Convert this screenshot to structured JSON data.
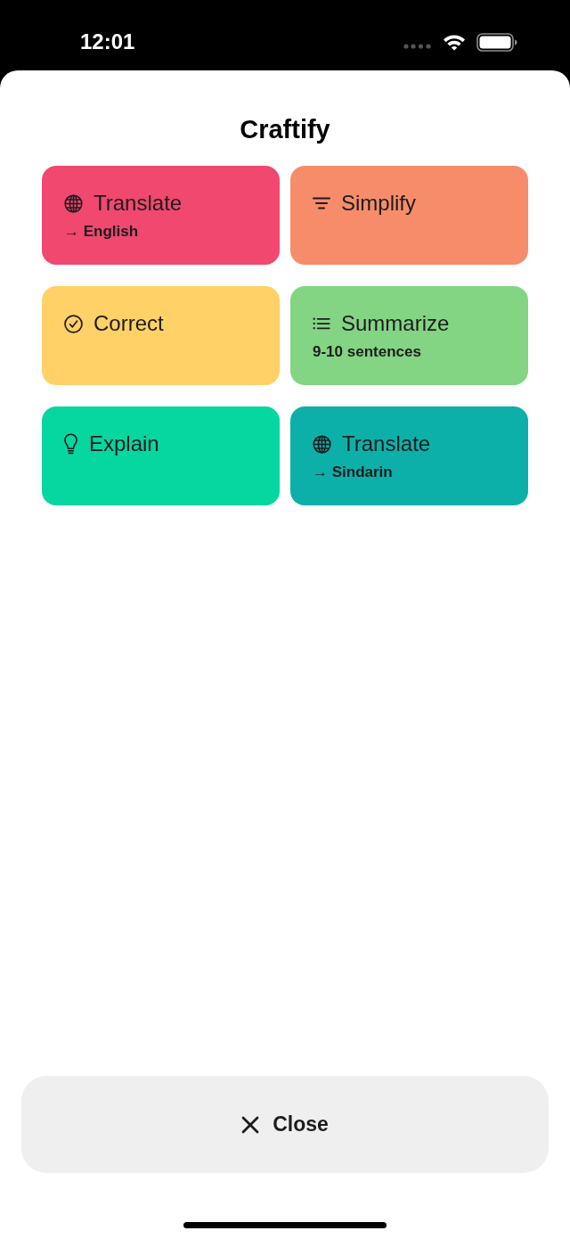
{
  "status_bar": {
    "time": "12:01"
  },
  "sheet": {
    "title": "Craftify"
  },
  "actions": [
    {
      "kind": "translate",
      "label": "Translate",
      "detail": "→ English",
      "color": "#f0486f"
    },
    {
      "kind": "simplify",
      "label": "Simplify",
      "color": "#f78c6b"
    },
    {
      "kind": "correct",
      "label": "Correct",
      "color": "#ffd166"
    },
    {
      "kind": "summarize",
      "label": "Summarize",
      "detail": "9-10 sentences",
      "color": "#83d483"
    },
    {
      "kind": "explain",
      "label": "Explain",
      "color": "#06d6a0"
    },
    {
      "kind": "translate",
      "label": "Translate",
      "detail": "→ Sindarin",
      "color": "#0cb0a9"
    }
  ],
  "close_button": {
    "label": "Close"
  }
}
